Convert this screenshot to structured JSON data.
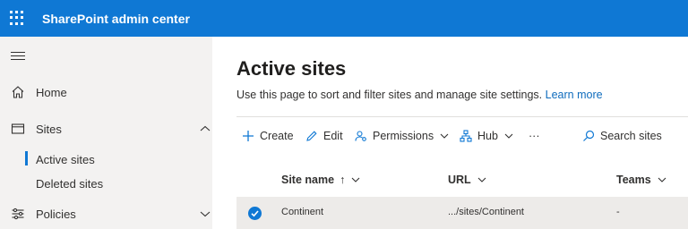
{
  "app": {
    "title": "SharePoint admin center"
  },
  "sidebar": {
    "items": [
      {
        "label": "Home",
        "icon": "home-icon"
      },
      {
        "label": "Sites",
        "icon": "sites-icon",
        "expanded": true
      },
      {
        "label": "Policies",
        "icon": "policies-icon",
        "expanded": false
      }
    ],
    "sites_children": [
      {
        "label": "Active sites",
        "active": true
      },
      {
        "label": "Deleted sites",
        "active": false
      }
    ]
  },
  "main": {
    "title": "Active sites",
    "description": "Use this page to sort and filter sites and manage site settings.",
    "learn_more": "Learn more",
    "toolbar": {
      "create": "Create",
      "edit": "Edit",
      "permissions": "Permissions",
      "hub": "Hub",
      "more": "···",
      "search": "Search sites"
    },
    "table": {
      "columns": [
        "Site name",
        "URL",
        "Teams"
      ],
      "sort_indicator": "↑",
      "rows": [
        {
          "selected": true,
          "site_name": "Continent",
          "url": ".../sites/Continent",
          "teams": "-"
        }
      ]
    }
  },
  "colors": {
    "accent": "#0f78d4",
    "sidebar_bg": "#f3f2f1",
    "selected_row": "#edebe9"
  }
}
